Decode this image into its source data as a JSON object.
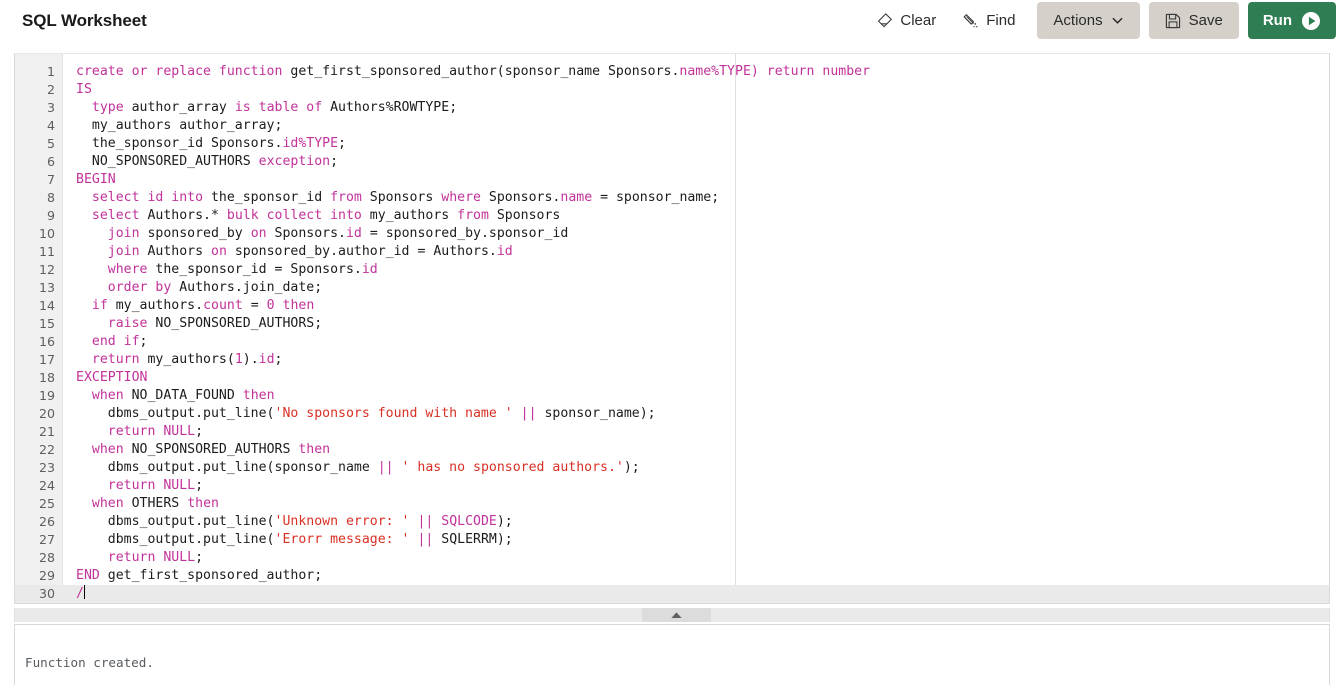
{
  "header": {
    "title": "SQL Worksheet",
    "actions": [
      {
        "name": "clear",
        "label": "Clear",
        "icon": "eraser-icon",
        "style": "plain"
      },
      {
        "name": "find",
        "label": "Find",
        "icon": "wand-icon",
        "style": "plain"
      },
      {
        "name": "actions",
        "label": "Actions",
        "icon": "chevron-down-icon",
        "style": "button"
      },
      {
        "name": "save",
        "label": "Save",
        "icon": "floppy-disk-icon",
        "style": "button"
      },
      {
        "name": "run",
        "label": "Run",
        "icon": "play-icon",
        "style": "run"
      }
    ]
  },
  "colors": {
    "run_button": "#2f7d52",
    "button": "#d5d1ca",
    "keyword": "#c2329a",
    "string": "#d93025",
    "gutter": "#f0f0f0",
    "active_line": "#eaeaea"
  },
  "editor": {
    "active_line": 30,
    "cursor_line": 30,
    "total_lines": 30,
    "lines": [
      {
        "n": 1,
        "tokens": [
          {
            "t": "create or replace function",
            "c": "kw"
          },
          {
            "t": " get_first_sponsored_author(sponsor_name Sponsors.",
            "c": ""
          },
          {
            "t": "name%TYPE",
            "c": "kw"
          },
          {
            "t": ")",
            "c": "op"
          },
          {
            "t": " ",
            "c": ""
          },
          {
            "t": "return number",
            "c": "kw"
          }
        ]
      },
      {
        "n": 2,
        "tokens": [
          {
            "t": "IS",
            "c": "kw"
          }
        ]
      },
      {
        "n": 3,
        "tokens": [
          {
            "t": "  ",
            "c": ""
          },
          {
            "t": "type",
            "c": "kw"
          },
          {
            "t": " author_array ",
            "c": ""
          },
          {
            "t": "is table of",
            "c": "kw"
          },
          {
            "t": " Authors%ROWTYPE;",
            "c": ""
          }
        ]
      },
      {
        "n": 4,
        "tokens": [
          {
            "t": "  my_authors author_array;",
            "c": ""
          }
        ]
      },
      {
        "n": 5,
        "tokens": [
          {
            "t": "  the_sponsor_id Sponsors.",
            "c": ""
          },
          {
            "t": "id%TYPE",
            "c": "kw"
          },
          {
            "t": ";",
            "c": ""
          }
        ]
      },
      {
        "n": 6,
        "tokens": [
          {
            "t": "  NO_SPONSORED_AUTHORS ",
            "c": ""
          },
          {
            "t": "exception",
            "c": "kw"
          },
          {
            "t": ";",
            "c": ""
          }
        ]
      },
      {
        "n": 7,
        "tokens": [
          {
            "t": "BEGIN",
            "c": "kw"
          }
        ]
      },
      {
        "n": 8,
        "tokens": [
          {
            "t": "  ",
            "c": ""
          },
          {
            "t": "select id into",
            "c": "kw"
          },
          {
            "t": " the_sponsor_id ",
            "c": ""
          },
          {
            "t": "from",
            "c": "kw"
          },
          {
            "t": " Sponsors ",
            "c": ""
          },
          {
            "t": "where",
            "c": "kw"
          },
          {
            "t": " Sponsors.",
            "c": ""
          },
          {
            "t": "name",
            "c": "kw"
          },
          {
            "t": " = sponsor_name;",
            "c": ""
          }
        ]
      },
      {
        "n": 9,
        "tokens": [
          {
            "t": "  ",
            "c": ""
          },
          {
            "t": "select",
            "c": "kw"
          },
          {
            "t": " Authors.* ",
            "c": ""
          },
          {
            "t": "bulk collect into",
            "c": "kw"
          },
          {
            "t": " my_authors ",
            "c": ""
          },
          {
            "t": "from",
            "c": "kw"
          },
          {
            "t": " Sponsors",
            "c": ""
          }
        ]
      },
      {
        "n": 10,
        "tokens": [
          {
            "t": "    ",
            "c": ""
          },
          {
            "t": "join",
            "c": "kw"
          },
          {
            "t": " sponsored_by ",
            "c": ""
          },
          {
            "t": "on",
            "c": "kw"
          },
          {
            "t": " Sponsors.",
            "c": ""
          },
          {
            "t": "id",
            "c": "kw"
          },
          {
            "t": " = sponsored_by.sponsor_id",
            "c": ""
          }
        ]
      },
      {
        "n": 11,
        "tokens": [
          {
            "t": "    ",
            "c": ""
          },
          {
            "t": "join",
            "c": "kw"
          },
          {
            "t": " Authors ",
            "c": ""
          },
          {
            "t": "on",
            "c": "kw"
          },
          {
            "t": " sponsored_by.author_id = Authors.",
            "c": ""
          },
          {
            "t": "id",
            "c": "kw"
          }
        ]
      },
      {
        "n": 12,
        "tokens": [
          {
            "t": "    ",
            "c": ""
          },
          {
            "t": "where",
            "c": "kw"
          },
          {
            "t": " the_sponsor_id = Sponsors.",
            "c": ""
          },
          {
            "t": "id",
            "c": "kw"
          }
        ]
      },
      {
        "n": 13,
        "tokens": [
          {
            "t": "    ",
            "c": ""
          },
          {
            "t": "order by",
            "c": "kw"
          },
          {
            "t": " Authors.join_date;",
            "c": ""
          }
        ]
      },
      {
        "n": 14,
        "tokens": [
          {
            "t": "  ",
            "c": ""
          },
          {
            "t": "if",
            "c": "kw"
          },
          {
            "t": " my_authors.",
            "c": ""
          },
          {
            "t": "count",
            "c": "kw"
          },
          {
            "t": " = ",
            "c": ""
          },
          {
            "t": "0",
            "c": "num"
          },
          {
            "t": " ",
            "c": ""
          },
          {
            "t": "then",
            "c": "kw"
          }
        ]
      },
      {
        "n": 15,
        "tokens": [
          {
            "t": "    ",
            "c": ""
          },
          {
            "t": "raise",
            "c": "kw"
          },
          {
            "t": " NO_SPONSORED_AUTHORS;",
            "c": ""
          }
        ]
      },
      {
        "n": 16,
        "tokens": [
          {
            "t": "  ",
            "c": ""
          },
          {
            "t": "end if",
            "c": "kw"
          },
          {
            "t": ";",
            "c": ""
          }
        ]
      },
      {
        "n": 17,
        "tokens": [
          {
            "t": "  ",
            "c": ""
          },
          {
            "t": "return",
            "c": "kw"
          },
          {
            "t": " my_authors(",
            "c": ""
          },
          {
            "t": "1",
            "c": "num"
          },
          {
            "t": ").",
            "c": ""
          },
          {
            "t": "id",
            "c": "kw"
          },
          {
            "t": ";",
            "c": ""
          }
        ]
      },
      {
        "n": 18,
        "tokens": [
          {
            "t": "EXCEPTION",
            "c": "kw"
          }
        ]
      },
      {
        "n": 19,
        "tokens": [
          {
            "t": "  ",
            "c": ""
          },
          {
            "t": "when",
            "c": "kw"
          },
          {
            "t": " NO_DATA_FOUND ",
            "c": ""
          },
          {
            "t": "then",
            "c": "kw"
          }
        ]
      },
      {
        "n": 20,
        "tokens": [
          {
            "t": "    dbms_output.put_line(",
            "c": ""
          },
          {
            "t": "'No sponsors found with name '",
            "c": "str"
          },
          {
            "t": " ",
            "c": ""
          },
          {
            "t": "||",
            "c": "op"
          },
          {
            "t": " sponsor_name);",
            "c": ""
          }
        ]
      },
      {
        "n": 21,
        "tokens": [
          {
            "t": "    ",
            "c": ""
          },
          {
            "t": "return NULL",
            "c": "kw"
          },
          {
            "t": ";",
            "c": ""
          }
        ]
      },
      {
        "n": 22,
        "tokens": [
          {
            "t": "  ",
            "c": ""
          },
          {
            "t": "when",
            "c": "kw"
          },
          {
            "t": " NO_SPONSORED_AUTHORS ",
            "c": ""
          },
          {
            "t": "then",
            "c": "kw"
          }
        ]
      },
      {
        "n": 23,
        "tokens": [
          {
            "t": "    dbms_output.put_line(sponsor_name ",
            "c": ""
          },
          {
            "t": "||",
            "c": "op"
          },
          {
            "t": " ",
            "c": ""
          },
          {
            "t": "' has no sponsored authors.'",
            "c": "str"
          },
          {
            "t": ");",
            "c": ""
          }
        ]
      },
      {
        "n": 24,
        "tokens": [
          {
            "t": "    ",
            "c": ""
          },
          {
            "t": "return NULL",
            "c": "kw"
          },
          {
            "t": ";",
            "c": ""
          }
        ]
      },
      {
        "n": 25,
        "tokens": [
          {
            "t": "  ",
            "c": ""
          },
          {
            "t": "when",
            "c": "kw"
          },
          {
            "t": " OTHERS ",
            "c": ""
          },
          {
            "t": "then",
            "c": "kw"
          }
        ]
      },
      {
        "n": 26,
        "tokens": [
          {
            "t": "    dbms_output.put_line(",
            "c": ""
          },
          {
            "t": "'Unknown error: '",
            "c": "str"
          },
          {
            "t": " ",
            "c": ""
          },
          {
            "t": "||",
            "c": "op"
          },
          {
            "t": " ",
            "c": ""
          },
          {
            "t": "SQLCODE",
            "c": "kw"
          },
          {
            "t": ");",
            "c": ""
          }
        ]
      },
      {
        "n": 27,
        "tokens": [
          {
            "t": "    dbms_output.put_line(",
            "c": ""
          },
          {
            "t": "'Erorr message: '",
            "c": "str"
          },
          {
            "t": " ",
            "c": ""
          },
          {
            "t": "||",
            "c": "op"
          },
          {
            "t": " SQLERRM);",
            "c": ""
          }
        ]
      },
      {
        "n": 28,
        "tokens": [
          {
            "t": "    ",
            "c": ""
          },
          {
            "t": "return NULL",
            "c": "kw"
          },
          {
            "t": ";",
            "c": ""
          }
        ]
      },
      {
        "n": 29,
        "tokens": [
          {
            "t": "END",
            "c": "kw"
          },
          {
            "t": " get_first_sponsored_author;",
            "c": ""
          }
        ]
      },
      {
        "n": 30,
        "tokens": [
          {
            "t": "/",
            "c": "kw"
          }
        ],
        "cursor": true
      }
    ]
  },
  "splitter": {
    "collapse_icon": "triangle-up-icon"
  },
  "output_panel": {
    "text": "Function created."
  }
}
